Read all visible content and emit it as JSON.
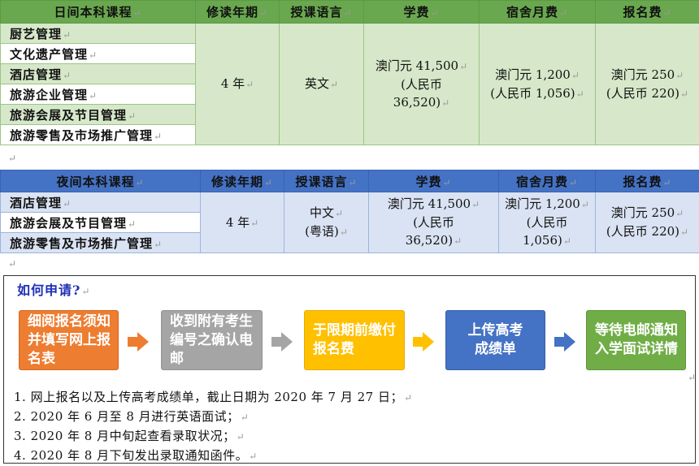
{
  "pm": "↵",
  "day_table": {
    "headers": [
      "日间本科课程",
      "修读年期",
      "授课语言",
      "学费",
      "宿舍月费",
      "报名费"
    ],
    "courses": [
      "厨艺管理",
      "文化遗产管理",
      "酒店管理",
      "旅游企业管理",
      "旅游会展及节目管理",
      "旅游零售及市场推广管理"
    ],
    "years": "4 年",
    "language": "英文",
    "tuition": [
      "澳门元 41,500",
      "(人民币",
      "36,520)"
    ],
    "dorm": [
      "澳门元 1,200",
      "(人民币 1,056)"
    ],
    "fee": [
      "澳门元 250",
      "(人民币 220)"
    ]
  },
  "night_table": {
    "headers": [
      "夜间本科课程",
      "修读年期",
      "授课语言",
      "学费",
      "宿舍月费",
      "报名费"
    ],
    "courses": [
      "酒店管理",
      "旅游会展及节目管理",
      "旅游零售及市场推广管理"
    ],
    "years": "4 年",
    "language": [
      "中文",
      "(粤语)"
    ],
    "tuition": [
      "澳门元 41,500",
      "(人民币",
      "36,520)"
    ],
    "dorm": [
      "澳门元 1,200",
      "(人民币",
      "1,056)"
    ],
    "fee": [
      "澳门元 250",
      "(人民币 220)"
    ]
  },
  "apply": {
    "title": "如何申请?",
    "steps": [
      {
        "lines": [
          "细阅报名须",
          "知并填写网",
          "上报名表"
        ],
        "color": "#ed7d31"
      },
      {
        "lines": [
          "收到附有考",
          "生编号之确",
          "认电邮"
        ],
        "color": "#a5a5a5"
      },
      {
        "lines": [
          "于限期前缴",
          "付报名费"
        ],
        "color": "#ffc000"
      },
      {
        "lines": [
          "上传高考",
          "成绩单"
        ],
        "color": "#4472c4"
      },
      {
        "lines": [
          "等待电邮通",
          "知入学面试",
          "详情"
        ],
        "color": "#70ad47"
      }
    ],
    "notes": [
      "1. 网上报名以及上传高考成绩单，截止日期为 2020 年 7 月 27 日；",
      "2. 2020 年 6 月至 8 月进行英语面试；",
      "3. 2020 年 8 月中旬起查看录取状况；",
      "4. 2020 年 8 月下旬发出录取通知函件。"
    ]
  }
}
